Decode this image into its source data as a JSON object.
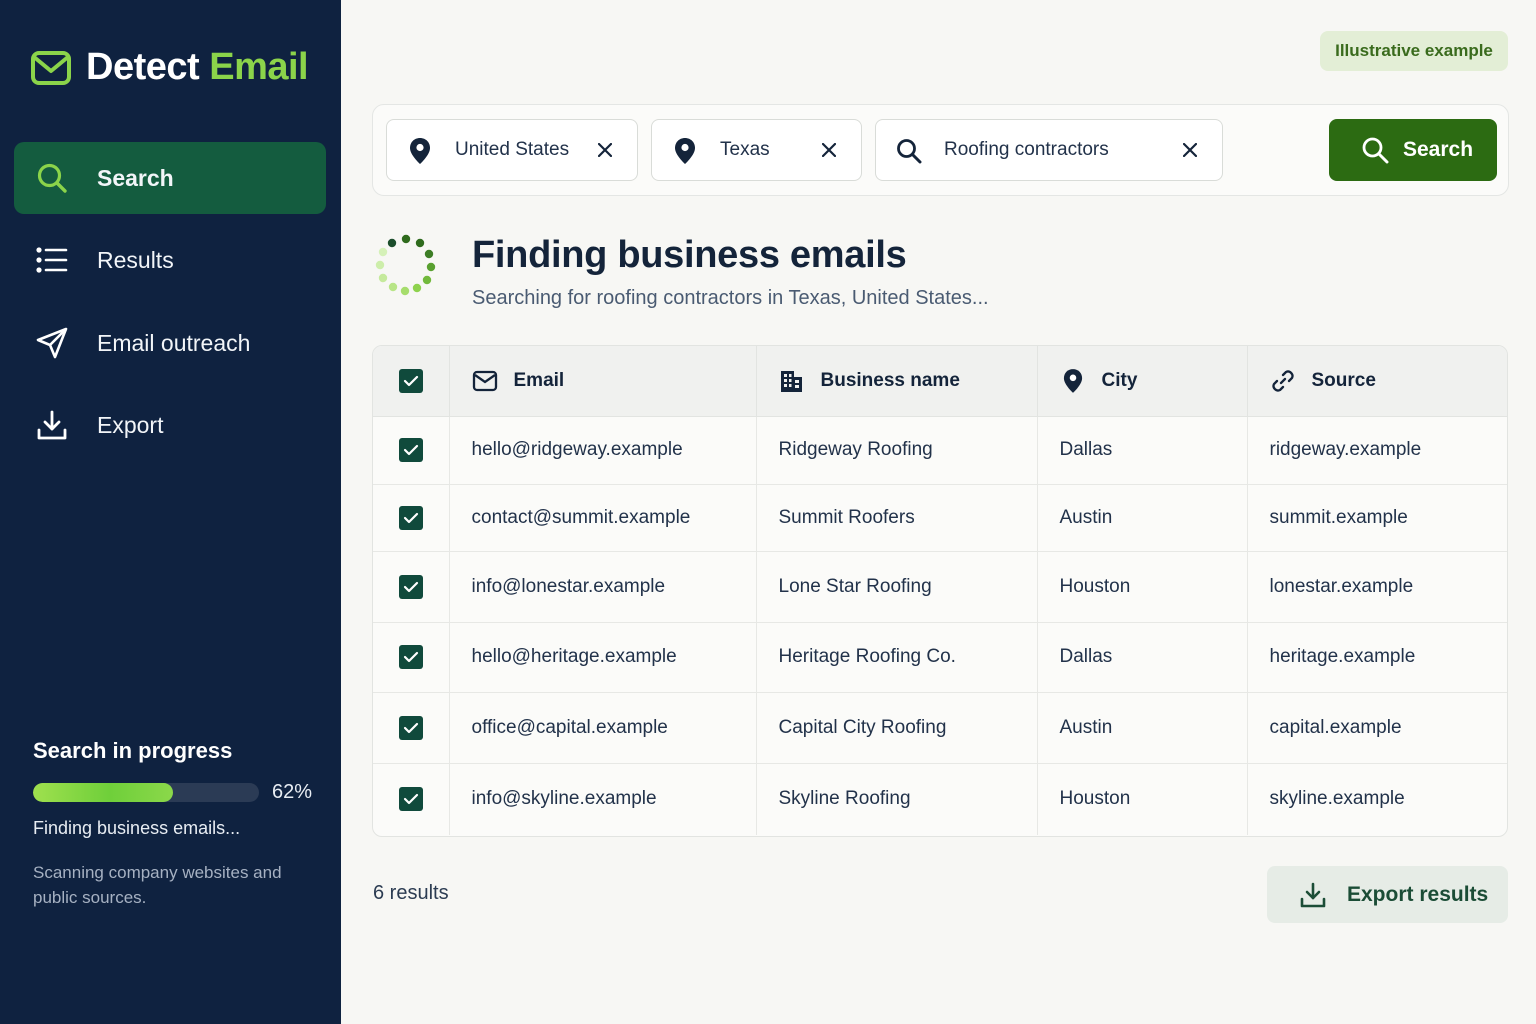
{
  "app": {
    "name_part1": "Detect",
    "name_part2": "Email",
    "accent_color": "#8bd44a",
    "sidebar_color": "#0f2240"
  },
  "sidebar": {
    "items": [
      {
        "label": "Search",
        "icon": "search-icon",
        "active": true
      },
      {
        "label": "Results",
        "icon": "list-icon",
        "active": false
      },
      {
        "label": "Email outreach",
        "icon": "send-icon",
        "active": false
      },
      {
        "label": "Export",
        "icon": "download-icon",
        "active": false
      }
    ],
    "progress": {
      "title": "Search in progress",
      "percent": 62,
      "percent_label": "62%",
      "status": "Finding business emails...",
      "note": "Scanning company websites and public sources."
    }
  },
  "badge": "Illustrative example",
  "filters": {
    "country": "United States",
    "state": "Texas",
    "query": "Roofing contractors"
  },
  "search_button": "Search",
  "heading": "Finding business emails",
  "subheading": "Searching for roofing contractors in Texas, United States...",
  "table": {
    "columns": [
      {
        "label": "Email",
        "icon": "mail-icon"
      },
      {
        "label": "Business name",
        "icon": "building-icon"
      },
      {
        "label": "City",
        "icon": "pin-icon"
      },
      {
        "label": "Source",
        "icon": "link-icon"
      }
    ],
    "rows": [
      {
        "email": "hello@ridgeway.example",
        "business": "Ridgeway Roofing",
        "city": "Dallas",
        "source": "ridgeway.example",
        "checked": true
      },
      {
        "email": "contact@summit.example",
        "business": "Summit Roofers",
        "city": "Austin",
        "source": "summit.example",
        "checked": true
      },
      {
        "email": "info@lonestar.example",
        "business": "Lone Star Roofing",
        "city": "Houston",
        "source": "lonestar.example",
        "checked": true
      },
      {
        "email": "hello@heritage.example",
        "business": "Heritage Roofing Co.",
        "city": "Dallas",
        "source": "heritage.example",
        "checked": true
      },
      {
        "email": "office@capital.example",
        "business": "Capital City Roofing",
        "city": "Austin",
        "source": "capital.example",
        "checked": true
      },
      {
        "email": "info@skyline.example",
        "business": "Skyline Roofing",
        "city": "Houston",
        "source": "skyline.example",
        "checked": true
      }
    ]
  },
  "results_count": "6 results",
  "export_button": "Export results"
}
